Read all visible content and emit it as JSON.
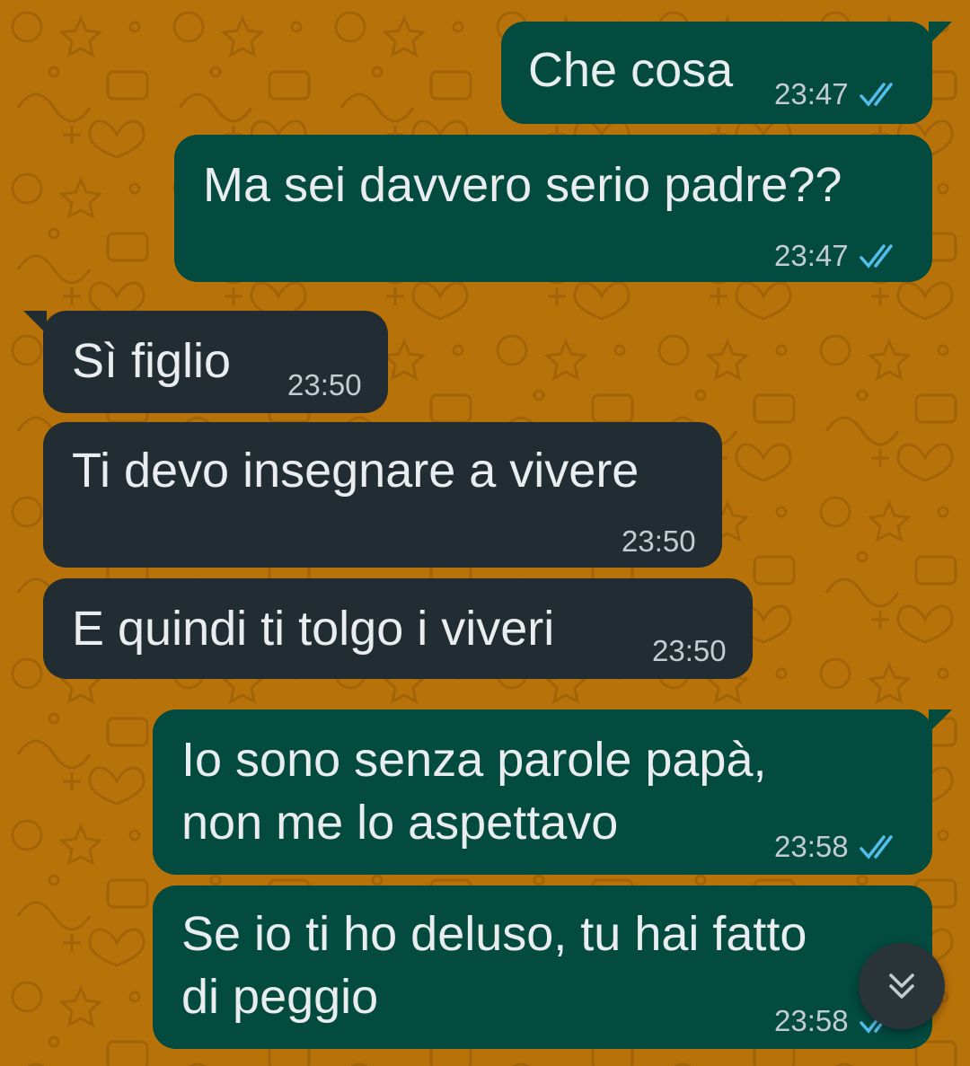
{
  "messages": [
    {
      "id": "m1",
      "direction": "outgoing",
      "text": "Che cosa",
      "time": "23:47",
      "status": "read"
    },
    {
      "id": "m2",
      "direction": "outgoing",
      "text": "Ma sei davvero serio padre??",
      "time": "23:47",
      "status": "read"
    },
    {
      "id": "m3",
      "direction": "incoming",
      "text": "Sì figlio",
      "time": "23:50"
    },
    {
      "id": "m4",
      "direction": "incoming",
      "text": "Ti devo insegnare a vivere",
      "time": "23:50"
    },
    {
      "id": "m5",
      "direction": "incoming",
      "text": "E quindi ti tolgo i viveri",
      "time": "23:50"
    },
    {
      "id": "m6",
      "direction": "outgoing",
      "text_line1": "Io sono senza parole papà,",
      "text_line2": "non me lo aspettavo",
      "time": "23:58",
      "status": "read"
    },
    {
      "id": "m7",
      "direction": "outgoing",
      "text_line1": "Se io ti ho deluso, tu hai fatto",
      "text_line2": "di peggio",
      "time": "23:58",
      "status": "read"
    }
  ],
  "icons": {
    "read_receipt": "double-check-icon",
    "scroll_down": "double-chevron-down-icon"
  },
  "colors": {
    "wallpaper": "#b8720a",
    "outgoing_bubble": "#034a3f",
    "incoming_bubble": "#222d33",
    "read_tick": "#53bdeb"
  }
}
